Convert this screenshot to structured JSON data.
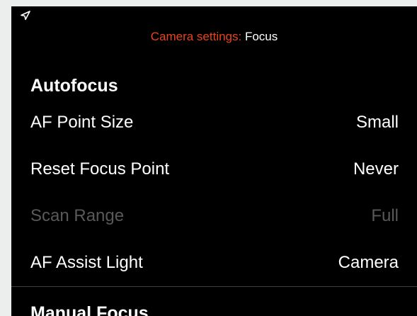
{
  "header": {
    "prefix": "Camera settings: ",
    "section": "Focus"
  },
  "status": {
    "icon": "location-arrow-icon"
  },
  "groups": [
    {
      "title": "Autofocus",
      "rows": [
        {
          "label": "AF Point Size",
          "value": "Small",
          "enabled": true
        },
        {
          "label": "Reset Focus Point",
          "value": "Never",
          "enabled": true
        },
        {
          "label": "Scan Range",
          "value": "Full",
          "enabled": false
        },
        {
          "label": "AF Assist Light",
          "value": "Camera",
          "enabled": true
        }
      ]
    },
    {
      "title": "Manual Focus"
    }
  ],
  "colors": {
    "accent": "#e8431b",
    "text": "#ffffff",
    "disabled_text": "#595959",
    "background": "#000000",
    "frame": "#eceded"
  }
}
